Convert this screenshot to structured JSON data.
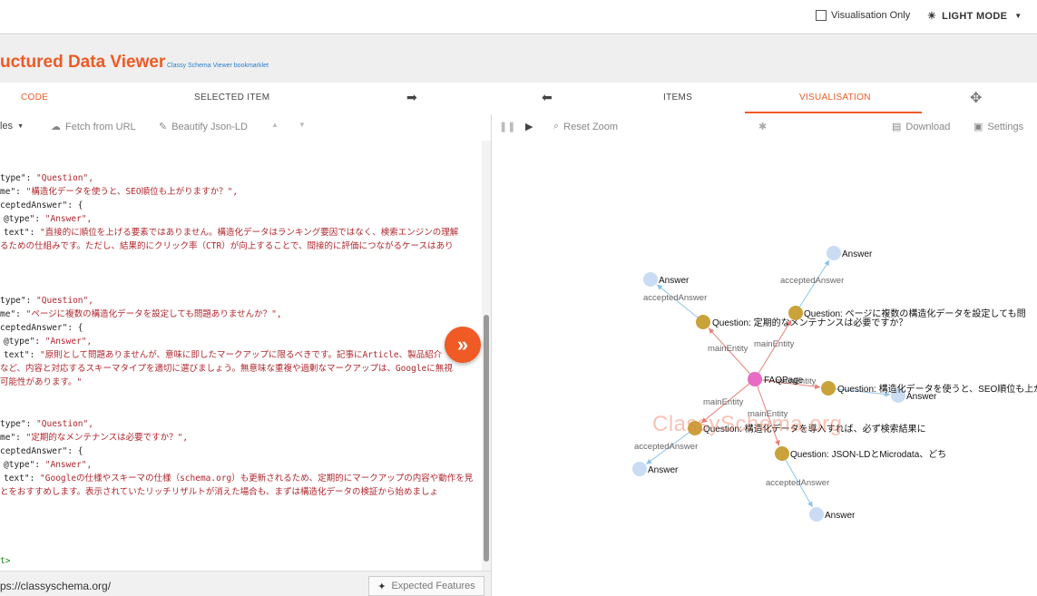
{
  "header": {
    "visualisation_only_label": "Visualisation Only",
    "light_mode_label": "LIGHT MODE",
    "app_title": "uctured Data Viewer",
    "app_subtitle": "Classy Schema Viewer bookmarklet"
  },
  "tabs": {
    "code": "CODE",
    "selected_item": "SELECTED ITEM",
    "items": "ITEMS",
    "visualisation": "VISUALISATION"
  },
  "toolbar": {
    "examples": "les",
    "fetch": "Fetch from URL",
    "beautify": "Beautify Json-LD",
    "reset_zoom": "Reset Zoom",
    "download": "Download",
    "settings": "Settings"
  },
  "code_lines": [
    {
      "parts": [
        {
          "t": "k",
          "v": "type\": "
        },
        {
          "t": "s",
          "v": "\"Question\","
        }
      ]
    },
    {
      "parts": [
        {
          "t": "k",
          "v": "me\": "
        },
        {
          "t": "s",
          "v": "\"構造化データを使うと、SEO順位も上がりますか？\","
        }
      ]
    },
    {
      "parts": [
        {
          "t": "k",
          "v": "ceptedAnswer\": {"
        }
      ]
    },
    {
      "parts": [
        {
          "t": "k",
          "v": "@type\": "
        },
        {
          "t": "s",
          "v": "\"Answer\","
        }
      ]
    },
    {
      "parts": [
        {
          "t": "k",
          "v": "text\": "
        },
        {
          "t": "s",
          "v": "\"直接的に順位を上げる要素ではありません。構造化データはランキング要因ではなく、検索エンジンの理解"
        }
      ]
    },
    {
      "parts": [
        {
          "t": "s",
          "v": "るための仕組みです。ただし、結果的にクリック率（CTR）が向上することで、間接的に評価につながるケースはあり"
        }
      ]
    },
    {
      "parts": [
        {
          "t": "k",
          "v": "type\": "
        },
        {
          "t": "s",
          "v": "\"Question\","
        }
      ]
    },
    {
      "parts": [
        {
          "t": "k",
          "v": "me\": "
        },
        {
          "t": "s",
          "v": "\"ページに複数の構造化データを設定しても問題ありませんか？\","
        }
      ]
    },
    {
      "parts": [
        {
          "t": "k",
          "v": "ceptedAnswer\": {"
        }
      ]
    },
    {
      "parts": [
        {
          "t": "k",
          "v": "@type\": "
        },
        {
          "t": "s",
          "v": "\"Answer\","
        }
      ]
    },
    {
      "parts": [
        {
          "t": "k",
          "v": "text\": "
        },
        {
          "t": "s",
          "v": "\"原則として問題ありませんが、意味に即したマークアップに限るべきです。記事にArticle、製品紹介"
        }
      ]
    },
    {
      "parts": [
        {
          "t": "s",
          "v": "など、内容と対応するスキーマタイプを適切に選びましょう。無意味な重複や過剰なマークアップは、Googleに無視"
        }
      ]
    },
    {
      "parts": [
        {
          "t": "s",
          "v": "可能性があります。\""
        }
      ]
    },
    {
      "parts": [
        {
          "t": "k",
          "v": "type\": "
        },
        {
          "t": "s",
          "v": "\"Question\","
        }
      ]
    },
    {
      "parts": [
        {
          "t": "k",
          "v": "me\": "
        },
        {
          "t": "s",
          "v": "\"定期的なメンテナンスは必要ですか？\","
        }
      ]
    },
    {
      "parts": [
        {
          "t": "k",
          "v": "ceptedAnswer\": {"
        }
      ]
    },
    {
      "parts": [
        {
          "t": "k",
          "v": "@type\": "
        },
        {
          "t": "s",
          "v": "\"Answer\","
        }
      ]
    },
    {
      "parts": [
        {
          "t": "k",
          "v": "text\": "
        },
        {
          "t": "s",
          "v": "\"Googleの仕様やスキーマの仕様（schema.org）も更新されるため、定期的にマークアップの内容や動作を見"
        }
      ]
    },
    {
      "parts": [
        {
          "t": "s",
          "v": "とをおすすめします。表示されていたリッチリザルトが消えた場合も、まずは構造化データの検証から始めましょ"
        }
      ]
    },
    {
      "parts": [
        {
          "t": "g",
          "v": "t>"
        }
      ]
    }
  ],
  "url": "ps://classyschema.org/",
  "expected_features": "Expected Features",
  "watermark": "ClassySchema.org",
  "graph": {
    "colors": {
      "center": "#e86bc4",
      "question": "#c9a23a",
      "answer": "#c9dcf3",
      "edge_main": "#e8807a",
      "edge_answer": "#8dc3e8"
    },
    "center_label": "FAQPage",
    "main_entity_label": "mainEntity",
    "accepted_answer_label": "acceptedAnswer",
    "answer_label": "Answer",
    "questions": [
      "Question: 定期的なメンテナンスは必要ですか？",
      "Question: ページに複数の構造化データを設定しても問",
      "Question: 構造化データを使うと、SEO順位も上が",
      "Question: 構造化データを導入すれば、必ず検索結果に",
      "Question: JSON-LDとMicrodata、どち"
    ]
  }
}
